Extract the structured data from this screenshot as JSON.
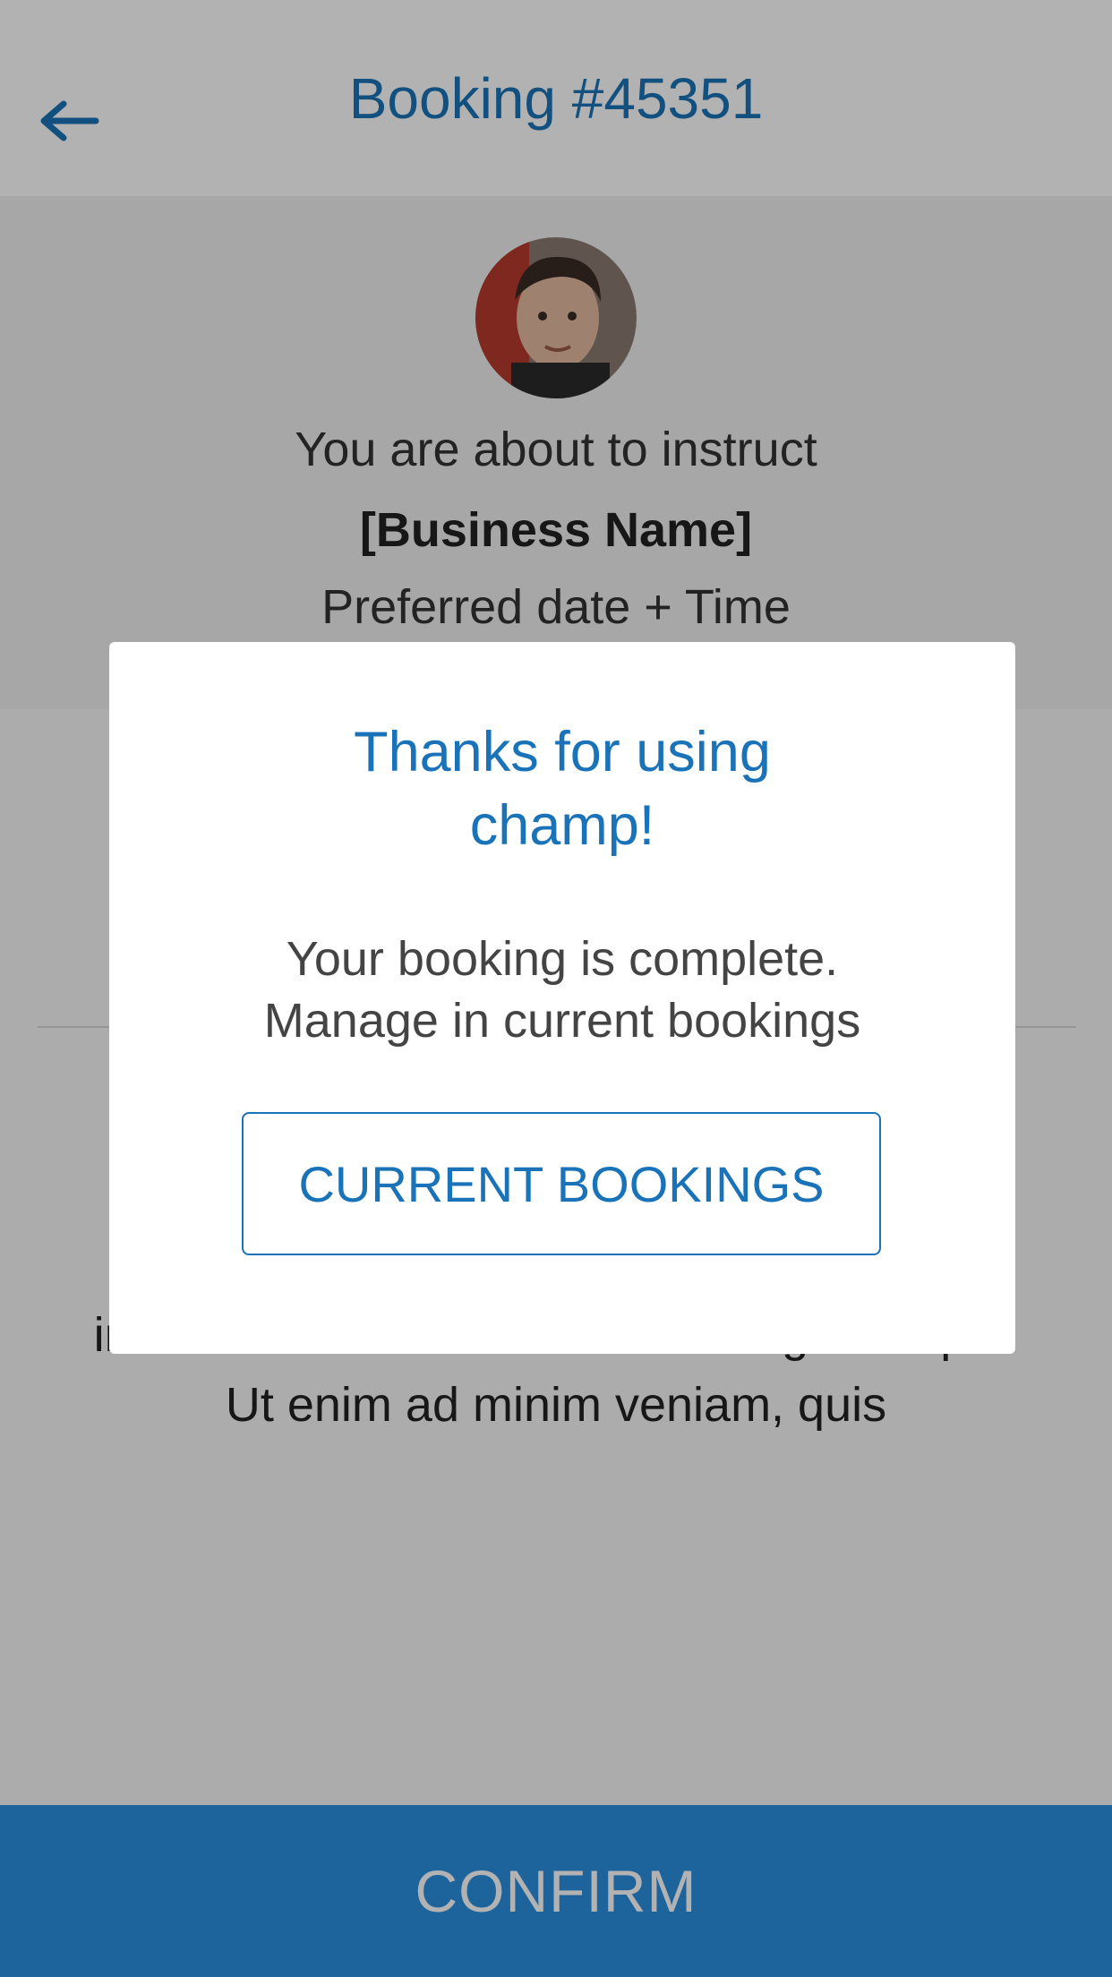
{
  "header": {
    "title": "Booking #45351",
    "back_icon": "arrow-left-icon"
  },
  "profile": {
    "avatar_icon": "avatar",
    "line1": "You are about to instruct",
    "line2": "[Business Name]",
    "line3": "Preferred date + Time"
  },
  "content": {
    "lorem_line1": "incididunt ut labore et dolore magna aliqua.",
    "lorem_line2": "Ut enim ad minim veniam, quis"
  },
  "confirm": {
    "label": "CONFIRM"
  },
  "modal": {
    "title_line1": "Thanks for using",
    "title_line2": "champ!",
    "message_line1": "Your booking is complete.",
    "message_line2": "Manage in current bookings",
    "button_label": "CURRENT BOOKINGS"
  },
  "colors": {
    "accent": "#1a73b8",
    "confirm_bar": "#2a8fe0"
  }
}
